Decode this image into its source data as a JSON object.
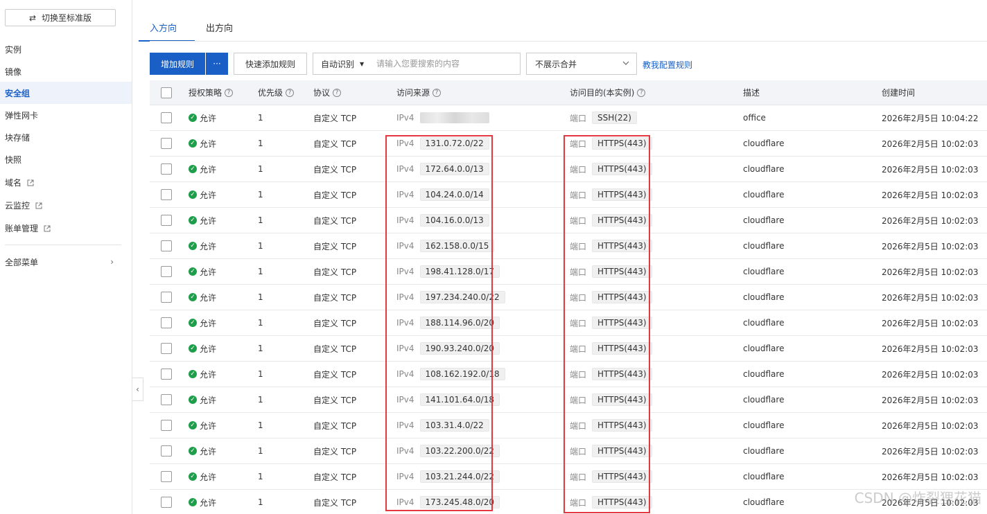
{
  "sidebar": {
    "switch_label": "切换至标准版",
    "items": [
      {
        "label": "实例",
        "external": false
      },
      {
        "label": "镜像",
        "external": false
      },
      {
        "label": "安全组",
        "external": false,
        "active": true
      },
      {
        "label": "弹性网卡",
        "external": false
      },
      {
        "label": "块存储",
        "external": false
      },
      {
        "label": "快照",
        "external": false
      },
      {
        "label": "域名",
        "external": true
      },
      {
        "label": "云监控",
        "external": true
      },
      {
        "label": "账单管理",
        "external": true
      }
    ],
    "all_menu": "全部菜单"
  },
  "tabs": [
    {
      "label": "入方向",
      "active": true
    },
    {
      "label": "出方向",
      "active": false
    }
  ],
  "toolbar": {
    "add_rule": "增加规则",
    "more": "···",
    "quick_add": "快速添加规则",
    "search_type": "自动识别",
    "search_placeholder": "请输入您要搜索的内容",
    "merge_select": "不展示合并",
    "help_link": "教我配置规则"
  },
  "table": {
    "headers": {
      "policy": "授权策略",
      "priority": "优先级",
      "protocol": "协议",
      "source": "访问来源",
      "destination": "访问目的(本实例)",
      "description": "描述",
      "created": "创建时间"
    },
    "rows": [
      {
        "policy": "允许",
        "priority": "1",
        "protocol": "自定义 TCP",
        "src_type": "IPv4",
        "src": "",
        "src_blurred": true,
        "port_label": "端口",
        "port": "SSH(22)",
        "desc": "office",
        "time": "2026年2月5日 10:04:22"
      },
      {
        "policy": "允许",
        "priority": "1",
        "protocol": "自定义 TCP",
        "src_type": "IPv4",
        "src": "131.0.72.0/22",
        "port_label": "端口",
        "port": "HTTPS(443)",
        "desc": "cloudflare",
        "time": "2026年2月5日 10:02:03"
      },
      {
        "policy": "允许",
        "priority": "1",
        "protocol": "自定义 TCP",
        "src_type": "IPv4",
        "src": "172.64.0.0/13",
        "port_label": "端口",
        "port": "HTTPS(443)",
        "desc": "cloudflare",
        "time": "2026年2月5日 10:02:03"
      },
      {
        "policy": "允许",
        "priority": "1",
        "protocol": "自定义 TCP",
        "src_type": "IPv4",
        "src": "104.24.0.0/14",
        "port_label": "端口",
        "port": "HTTPS(443)",
        "desc": "cloudflare",
        "time": "2026年2月5日 10:02:03"
      },
      {
        "policy": "允许",
        "priority": "1",
        "protocol": "自定义 TCP",
        "src_type": "IPv4",
        "src": "104.16.0.0/13",
        "port_label": "端口",
        "port": "HTTPS(443)",
        "desc": "cloudflare",
        "time": "2026年2月5日 10:02:03"
      },
      {
        "policy": "允许",
        "priority": "1",
        "protocol": "自定义 TCP",
        "src_type": "IPv4",
        "src": "162.158.0.0/15",
        "port_label": "端口",
        "port": "HTTPS(443)",
        "desc": "cloudflare",
        "time": "2026年2月5日 10:02:03"
      },
      {
        "policy": "允许",
        "priority": "1",
        "protocol": "自定义 TCP",
        "src_type": "IPv4",
        "src": "198.41.128.0/17",
        "port_label": "端口",
        "port": "HTTPS(443)",
        "desc": "cloudflare",
        "time": "2026年2月5日 10:02:03"
      },
      {
        "policy": "允许",
        "priority": "1",
        "protocol": "自定义 TCP",
        "src_type": "IPv4",
        "src": "197.234.240.0/22",
        "port_label": "端口",
        "port": "HTTPS(443)",
        "desc": "cloudflare",
        "time": "2026年2月5日 10:02:03"
      },
      {
        "policy": "允许",
        "priority": "1",
        "protocol": "自定义 TCP",
        "src_type": "IPv4",
        "src": "188.114.96.0/20",
        "port_label": "端口",
        "port": "HTTPS(443)",
        "desc": "cloudflare",
        "time": "2026年2月5日 10:02:03"
      },
      {
        "policy": "允许",
        "priority": "1",
        "protocol": "自定义 TCP",
        "src_type": "IPv4",
        "src": "190.93.240.0/20",
        "port_label": "端口",
        "port": "HTTPS(443)",
        "desc": "cloudflare",
        "time": "2026年2月5日 10:02:03"
      },
      {
        "policy": "允许",
        "priority": "1",
        "protocol": "自定义 TCP",
        "src_type": "IPv4",
        "src": "108.162.192.0/18",
        "port_label": "端口",
        "port": "HTTPS(443)",
        "desc": "cloudflare",
        "time": "2026年2月5日 10:02:03"
      },
      {
        "policy": "允许",
        "priority": "1",
        "protocol": "自定义 TCP",
        "src_type": "IPv4",
        "src": "141.101.64.0/18",
        "port_label": "端口",
        "port": "HTTPS(443)",
        "desc": "cloudflare",
        "time": "2026年2月5日 10:02:03"
      },
      {
        "policy": "允许",
        "priority": "1",
        "protocol": "自定义 TCP",
        "src_type": "IPv4",
        "src": "103.31.4.0/22",
        "port_label": "端口",
        "port": "HTTPS(443)",
        "desc": "cloudflare",
        "time": "2026年2月5日 10:02:03"
      },
      {
        "policy": "允许",
        "priority": "1",
        "protocol": "自定义 TCP",
        "src_type": "IPv4",
        "src": "103.22.200.0/22",
        "port_label": "端口",
        "port": "HTTPS(443)",
        "desc": "cloudflare",
        "time": "2026年2月5日 10:02:03"
      },
      {
        "policy": "允许",
        "priority": "1",
        "protocol": "自定义 TCP",
        "src_type": "IPv4",
        "src": "103.21.244.0/22",
        "port_label": "端口",
        "port": "HTTPS(443)",
        "desc": "cloudflare",
        "time": "2026年2月5日 10:02:03"
      },
      {
        "policy": "允许",
        "priority": "1",
        "protocol": "自定义 TCP",
        "src_type": "IPv4",
        "src": "173.245.48.0/20",
        "port_label": "端口",
        "port": "HTTPS(443)",
        "desc": "cloudflare",
        "time": "2026年2月5日 10:02:03"
      }
    ]
  },
  "highlight_color": "#e5373f",
  "accent_color": "#1a5fc6",
  "watermark": "CSDN @炸裂狸花猫"
}
